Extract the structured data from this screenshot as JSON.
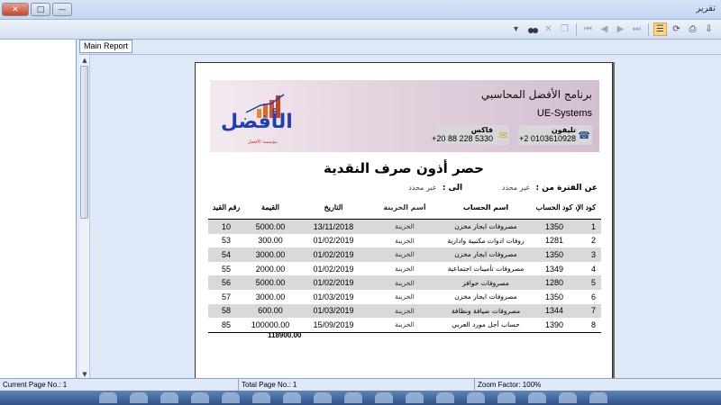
{
  "window": {
    "title": "تقرير",
    "close_glyph": "✕",
    "max_glyph": "□",
    "min_glyph": "—"
  },
  "toolbar": {
    "icons": [
      "binoculars-icon",
      "search-icon",
      "close-icon",
      "copy-icon",
      "first-page-icon",
      "prev-page-icon",
      "next-page-icon",
      "last-page-icon",
      "group-tree-icon",
      "refresh-icon",
      "print-icon",
      "export-icon"
    ]
  },
  "tab": {
    "label": "Main Report"
  },
  "report": {
    "company_ar": "برنامج الأفضل المحاسبي",
    "company_en": "UE-Systems",
    "phone_label": "تليفون",
    "phone_value": "+2 0103610928",
    "fax_label": "فاكس",
    "fax_value": "+20 88 228 5330",
    "logo_text": "الأفضل",
    "logo_sub": "مؤسسة الأفضل",
    "title": "حصر أذون صرف النقدية",
    "period_from_label": "عن الفترة من :",
    "period_from_value": "غير محدد",
    "period_to_label": "الى :",
    "period_to_value": "غير محدد",
    "columns": {
      "id": "كود الإذن",
      "account_code": "كود الحساب",
      "account_name": "اسم الحساب",
      "box_name": "أسم الخزينة",
      "date": "التاريخ",
      "value": "القيمة",
      "ref": "رقم القيد"
    },
    "rows": [
      {
        "id": "1",
        "account_code": "1350",
        "account_name": "مصروفات ايجار مخزن",
        "box_name": "الخزينة",
        "date": "13/11/2018",
        "value": "5000.00",
        "ref": "10"
      },
      {
        "id": "2",
        "account_code": "1281",
        "account_name": "روفات ادوات مكتبية وادارية",
        "box_name": "الخزينة",
        "date": "01/02/2019",
        "value": "300.00",
        "ref": "53"
      },
      {
        "id": "3",
        "account_code": "1350",
        "account_name": "مصروفات ايجار مخزن",
        "box_name": "الخزينة",
        "date": "01/02/2019",
        "value": "3000.00",
        "ref": "54"
      },
      {
        "id": "4",
        "account_code": "1349",
        "account_name": "مصروفات تأمينات اجتماعية",
        "box_name": "الخزينة",
        "date": "01/02/2019",
        "value": "2000.00",
        "ref": "55"
      },
      {
        "id": "5",
        "account_code": "1280",
        "account_name": "مصروفات حوافز",
        "box_name": "الخزينة",
        "date": "01/02/2019",
        "value": "5000.00",
        "ref": "56"
      },
      {
        "id": "6",
        "account_code": "1350",
        "account_name": "مصروفات ايجار مخزن",
        "box_name": "الخزينة",
        "date": "01/03/2019",
        "value": "3000.00",
        "ref": "57"
      },
      {
        "id": "7",
        "account_code": "1344",
        "account_name": "مصروفات ضيافة ونظافة",
        "box_name": "الخزينة",
        "date": "01/03/2019",
        "value": "600.00",
        "ref": "58"
      },
      {
        "id": "8",
        "account_code": "1390",
        "account_name": "حساب أجل مورد العربي",
        "box_name": "الخزينة",
        "date": "15/09/2019",
        "value": "100000.00",
        "ref": "85"
      }
    ],
    "total": "118900.00"
  },
  "status": {
    "current_page": "Current Page No.: 1",
    "total_page": "Total Page No.: 1",
    "zoom": "Zoom Factor: 100%"
  }
}
